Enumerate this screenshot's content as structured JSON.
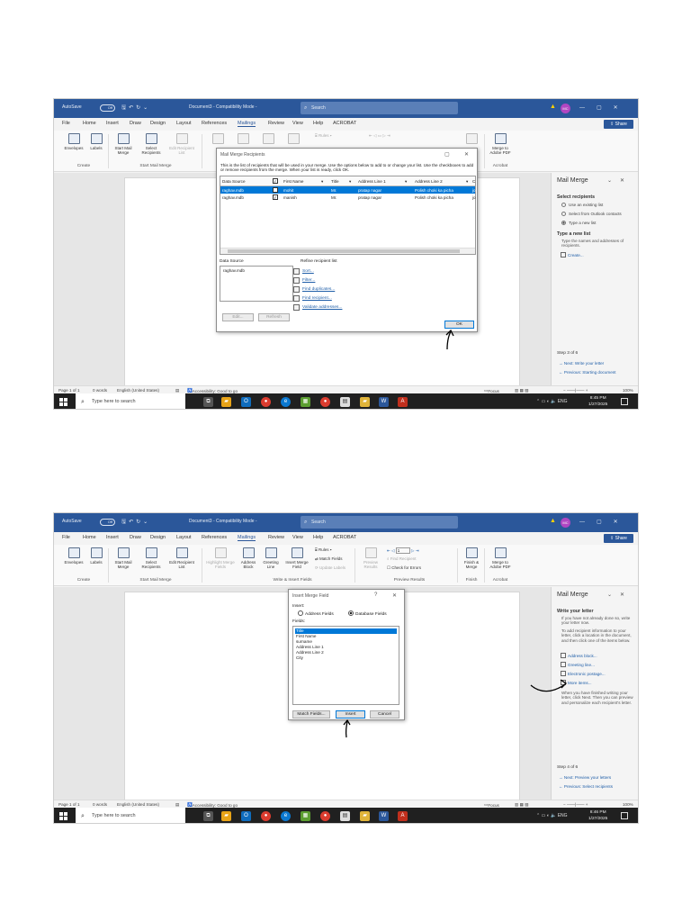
{
  "window": {
    "autosave_label": "AutoSave",
    "autosave_state": "Off",
    "doc_title": "Document3 - Compatibility Mode -",
    "search_placeholder": "Search",
    "user_initials": "MC",
    "share_label": "Share"
  },
  "menu": [
    "File",
    "Home",
    "Insert",
    "Draw",
    "Design",
    "Layout",
    "References",
    "Mailings",
    "Review",
    "View",
    "Help",
    "ACROBAT"
  ],
  "menu_active": "Mailings",
  "ribbon": {
    "envelopes": "Envelopes",
    "labels": "Labels",
    "start_mail_merge": "Start Mail Merge",
    "select_recipients": "Select Recipients",
    "edit_recipient_list": "Edit Recipient List",
    "highlight_merge_fields": "Highlight Merge Fields",
    "address_block": "Address Block",
    "greeting_line": "Greeting Line",
    "insert_merge_field": "Insert Merge Field",
    "rules": "Rules",
    "match_fields": "Match Fields",
    "update_labels": "Update Labels",
    "preview_results": "Preview Results",
    "find_recipient": "Find Recipient",
    "check_for_errors": "Check for Errors",
    "finish_merge": "Finish & Merge",
    "merge_to_pdf": "Merge to Adobe PDF",
    "record_number": "1",
    "groups": {
      "create": "Create",
      "start_mail_merge": "Start Mail Merge",
      "write_insert": "Write & Insert Fields",
      "preview": "Preview Results",
      "finish": "Finish",
      "acrobat": "Acrobat"
    }
  },
  "status": {
    "page": "Page 1 of 1",
    "words": "0 words",
    "language": "English (United States)",
    "accessibility": "Accessibility: Good to go",
    "focus": "Focus",
    "zoom": "100%"
  },
  "taskbar": {
    "search_placeholder": "Type here to search",
    "lang": "ENG",
    "date": "1/27/2025"
  },
  "screenshot1": {
    "time": "8:45 PM",
    "pane": {
      "title": "Mail Merge",
      "select_heading": "Select recipients",
      "options": [
        "Use an existing list",
        "Select from Outlook contacts",
        "Type a new list"
      ],
      "type_heading": "Type a new list",
      "type_text": "Type the names and addresses of recipients.",
      "create_link": "Create...",
      "step": "Step 3 of 6",
      "next": "Next: Write your letter",
      "previous": "Previous: Starting document"
    },
    "dialog": {
      "title": "Mail Merge Recipients",
      "intro": "This is the list of recipients that will be used in your merge.  Use the options below to add to or change your list.  Use the checkboxes to add or remove recipients from the merge.  When your list is ready, click OK.",
      "columns": [
        "Data Source",
        "First Name",
        "Title",
        "Address Line 1",
        "Address Line 2",
        "C"
      ],
      "rows": [
        {
          "source": "raghav.mdb",
          "first": "mohit",
          "title": "Mr.",
          "addr1": "pratap nagar",
          "addr2": "Polish choki ka picha",
          "extra": "jo"
        },
        {
          "source": "raghav.mdb",
          "first": "manish",
          "title": "Mr.",
          "addr1": "pratap nagar",
          "addr2": "Polish choki ka picha",
          "extra": "jo"
        }
      ],
      "data_source_label": "Data Source",
      "data_source_item": "raghav.mdb",
      "refine_label": "Refine recipient list",
      "refine_links": [
        "Sort...",
        "Filter...",
        "Find duplicates...",
        "Find recipient...",
        "Validate addresses..."
      ],
      "edit_button": "Edit...",
      "refresh_button": "Refresh",
      "ok_button": "OK"
    }
  },
  "screenshot2": {
    "time": "8:46 PM",
    "pane": {
      "title": "Mail Merge",
      "heading": "Write your letter",
      "text1": "If you have not already done so, write your letter now.",
      "text2": "To add recipient information to your letter, click a location in the document, and then click one of the items below.",
      "links": [
        "Address block...",
        "Greeting line...",
        "Electronic postage...",
        "More items..."
      ],
      "text3": "When you have finished writing your letter, click Next. Then you can preview and personalize each recipient's letter.",
      "step": "Step 4 of 6",
      "next": "Next: Preview your letters",
      "previous": "Previous: Select recipients"
    },
    "dialog": {
      "title": "Insert Merge Field",
      "insert_label": "Insert:",
      "address_fields": "Address Fields",
      "database_fields": "Database Fields",
      "fields_label": "Fields:",
      "fields": [
        "Title",
        "First Name",
        "surname",
        "Address Line 1",
        "Address Line 2",
        "City"
      ],
      "match_fields_button": "Match Fields...",
      "insert_button": "Insert",
      "cancel_button": "Cancel"
    }
  }
}
